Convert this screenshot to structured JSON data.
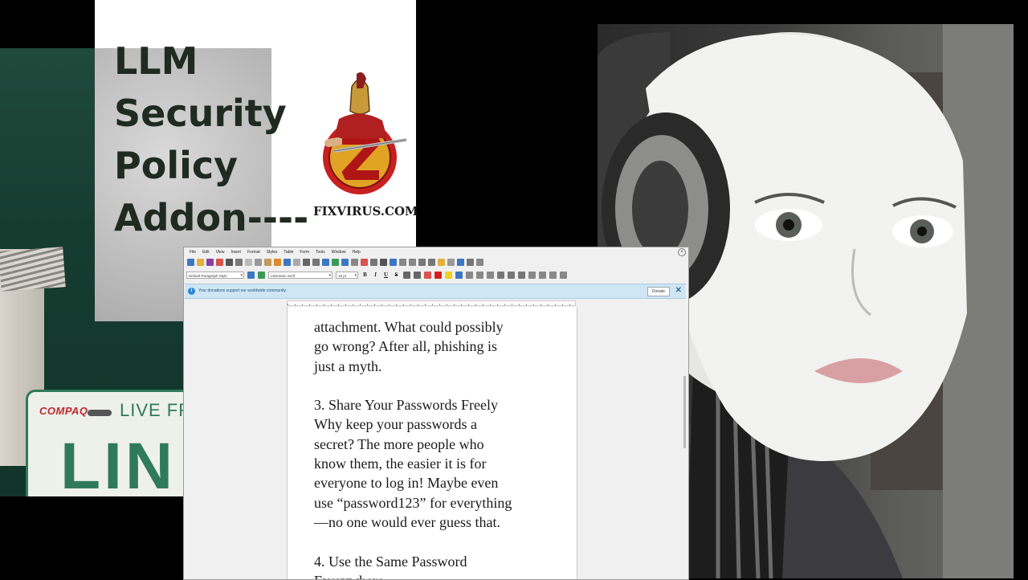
{
  "title_panel": {
    "lines": [
      "LLM",
      "Security",
      "Policy",
      "Addon----"
    ],
    "logo_text": "FIXVIRUS.COM"
  },
  "license_plate": {
    "brand": "COMPAQ",
    "slogan": "LIVE FR",
    "number": "LIN"
  },
  "writer": {
    "menu": [
      "File",
      "Edit",
      "View",
      "Insert",
      "Format",
      "Styles",
      "Table",
      "Form",
      "Tools",
      "Window",
      "Help"
    ],
    "paragraph_style": "Default Paragraph Style",
    "font_name": "Liberation Serif",
    "font_size": "18 pt",
    "format_buttons": [
      "B",
      "I",
      "U",
      "S"
    ],
    "infobar": {
      "message": "Your donations support our worldwide community.",
      "donate_label": "Donate",
      "close_label": "✕"
    },
    "document_lines": [
      "attachment. What could possibly",
      "go wrong? After all, phishing is",
      "just a myth.",
      "",
      "3. Share Your Passwords Freely",
      "Why keep your passwords a",
      "secret? The more people who",
      "know them, the easier it is for",
      "everyone to log in! Maybe even",
      "use “password123” for everything",
      "—no one would ever guess that.",
      "",
      "4. Use the Same Password",
      "Everywhere"
    ]
  },
  "colors": {
    "title_text": "#1f2a20",
    "infobar_bg": "#cfe6f5",
    "plate_green": "#2f7a5a"
  }
}
